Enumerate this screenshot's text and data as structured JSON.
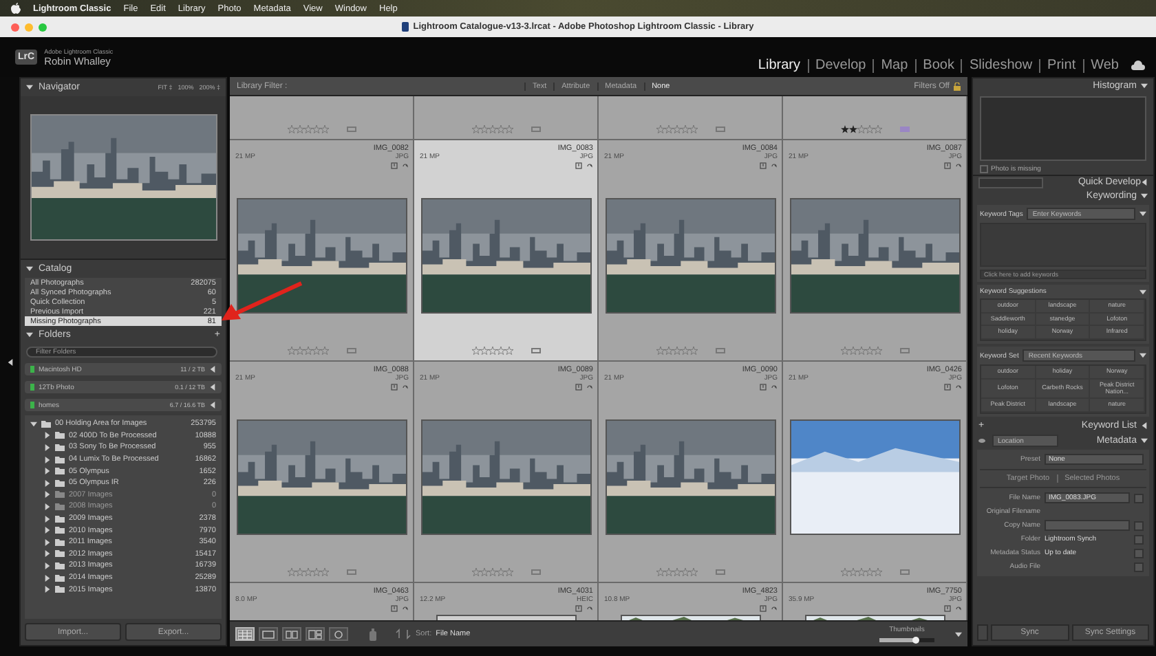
{
  "menu_bar": {
    "app": "Lightroom Classic",
    "items": [
      "File",
      "Edit",
      "Library",
      "Photo",
      "Metadata",
      "View",
      "Window",
      "Help"
    ]
  },
  "window": {
    "title": "Lightroom Catalogue-v13-3.lrcat - Adobe Photoshop Lightroom Classic - Library"
  },
  "identity": {
    "logo": "LrC",
    "product": "Adobe Lightroom Classic",
    "user": "Robin Whalley"
  },
  "modules": [
    {
      "label": "Library",
      "selected": true
    },
    {
      "label": "Develop",
      "selected": false
    },
    {
      "label": "Map",
      "selected": false
    },
    {
      "label": "Book",
      "selected": false
    },
    {
      "label": "Slideshow",
      "selected": false
    },
    {
      "label": "Print",
      "selected": false
    },
    {
      "label": "Web",
      "selected": false
    }
  ],
  "navigator": {
    "title": "Navigator",
    "zoom_options": [
      "FIT ‡",
      "100%",
      "200% ‡"
    ]
  },
  "catalog": {
    "title": "Catalog",
    "items": [
      {
        "label": "All Photographs",
        "count": "282075",
        "selected": false
      },
      {
        "label": "All Synced Photographs",
        "count": "60",
        "selected": false
      },
      {
        "label": "Quick Collection",
        "count": "5",
        "selected": false
      },
      {
        "label": "Previous Import",
        "count": "221",
        "selected": false
      },
      {
        "label": "Missing Photographs",
        "count": "81",
        "selected": true
      }
    ]
  },
  "folders": {
    "title": "Folders",
    "add": "+",
    "filter_placeholder": "Filter Folders",
    "volumes": [
      {
        "name": "Macintosh HD",
        "usage": "11 / 2 TB"
      },
      {
        "name": "12Tb Photo",
        "usage": "0.1 / 12 TB"
      },
      {
        "name": "homes",
        "usage": "6.7 / 16.6 TB"
      }
    ],
    "tree": [
      {
        "label": "00 Holding Area for Images",
        "count": "253795",
        "expanded": true,
        "disabled": false,
        "children": [
          {
            "label": "02 400D To Be Processed",
            "count": "10888",
            "expanded": false,
            "disabled": false
          },
          {
            "label": "03 Sony To Be Processed",
            "count": "955",
            "expanded": false,
            "disabled": false
          },
          {
            "label": "04 Lumix To Be Processed",
            "count": "16862",
            "expanded": false,
            "disabled": false
          },
          {
            "label": "05 Olympus",
            "count": "1652",
            "expanded": false,
            "disabled": false
          },
          {
            "label": "05 Olympus IR",
            "count": "226",
            "expanded": false,
            "disabled": false
          },
          {
            "label": "2007 Images",
            "count": "0",
            "expanded": false,
            "disabled": true
          },
          {
            "label": "2008 Images",
            "count": "0",
            "expanded": false,
            "disabled": true
          },
          {
            "label": "2009 Images",
            "count": "2378",
            "expanded": false,
            "disabled": false
          },
          {
            "label": "2010 Images",
            "count": "7970",
            "expanded": false,
            "disabled": false
          },
          {
            "label": "2011 Images",
            "count": "3540",
            "expanded": false,
            "disabled": false
          },
          {
            "label": "2012 Images",
            "count": "15417",
            "expanded": false,
            "disabled": false
          },
          {
            "label": "2013 Images",
            "count": "16739",
            "expanded": false,
            "disabled": false
          },
          {
            "label": "2014 Images",
            "count": "25289",
            "expanded": false,
            "disabled": false
          },
          {
            "label": "2015 Images",
            "count": "13870",
            "expanded": false,
            "disabled": false
          }
        ]
      }
    ]
  },
  "left_buttons": [
    "Import...",
    "Export..."
  ],
  "library_filter": {
    "label": "Library Filter :",
    "tabs": [
      {
        "label": "Text",
        "selected": false
      },
      {
        "label": "Attribute",
        "selected": false
      },
      {
        "label": "Metadata",
        "selected": false
      },
      {
        "label": "None",
        "selected": true
      }
    ],
    "status": "Filters Off"
  },
  "grid": {
    "rows": [
      {
        "kind": "footer",
        "cells": [
          {
            "stars": 0
          },
          {
            "stars": 0
          },
          {
            "stars": 0
          },
          {
            "stars": 2,
            "color": "#9a86c4"
          }
        ]
      },
      {
        "kind": "full",
        "cells": [
          {
            "name": "IMG_0082",
            "megapixels": "21 MP",
            "format": "JPG",
            "selected": false,
            "stars": 0,
            "kind": "city"
          },
          {
            "name": "IMG_0083",
            "megapixels": "21 MP",
            "format": "JPG",
            "selected": true,
            "stars": 0,
            "kind": "city"
          },
          {
            "name": "IMG_0084",
            "megapixels": "21 MP",
            "format": "JPG",
            "selected": false,
            "stars": 0,
            "kind": "city"
          },
          {
            "name": "IMG_0087",
            "megapixels": "21 MP",
            "format": "JPG",
            "selected": false,
            "stars": 0,
            "kind": "city"
          }
        ]
      },
      {
        "kind": "full",
        "cells": [
          {
            "name": "IMG_0088",
            "megapixels": "21 MP",
            "format": "JPG",
            "selected": false,
            "stars": 0,
            "kind": "city"
          },
          {
            "name": "IMG_0089",
            "megapixels": "21 MP",
            "format": "JPG",
            "selected": false,
            "stars": 0,
            "kind": "city"
          },
          {
            "name": "IMG_0090",
            "megapixels": "21 MP",
            "format": "JPG",
            "selected": false,
            "stars": 0,
            "kind": "city"
          },
          {
            "name": "IMG_0426",
            "megapixels": "21 MP",
            "format": "JPG",
            "selected": false,
            "stars": 0,
            "kind": "snow"
          }
        ]
      },
      {
        "kind": "header",
        "cells": [
          {
            "name": "IMG_0463",
            "megapixels": "8.0 MP",
            "format": "JPG",
            "selected": false,
            "kind": "none"
          },
          {
            "name": "IMG_4031",
            "megapixels": "12.2 MP",
            "format": "HEIC",
            "selected": false,
            "kind": "frame"
          },
          {
            "name": "IMG_4823",
            "megapixels": "10.8 MP",
            "format": "JPG",
            "selected": false,
            "kind": "trees"
          },
          {
            "name": "IMG_7750",
            "megapixels": "35.9 MP",
            "format": "JPG",
            "selected": false,
            "kind": "trees"
          }
        ]
      }
    ]
  },
  "toolbar": {
    "view_modes": [
      {
        "kind": "grid",
        "selected": true
      },
      {
        "kind": "loupe",
        "selected": false
      },
      {
        "kind": "compare",
        "selected": false
      },
      {
        "kind": "survey",
        "selected": false
      },
      {
        "kind": "people",
        "selected": false
      }
    ],
    "sort_label": "Sort:",
    "sort_value": "File Name",
    "thumbnails": {
      "label": "Thumbnails",
      "level": 0.65
    }
  },
  "histogram": {
    "title": "Histogram",
    "note": "Photo is missing",
    "checked": false
  },
  "quick_develop": {
    "title": "Quick Develop"
  },
  "keywording": {
    "title": "Keywording",
    "tags_label": "Keyword Tags",
    "tags_value": "Enter Keywords",
    "add_placeholder": "Click here to add keywords",
    "suggestions_title": "Keyword Suggestions",
    "suggestions": [
      "outdoor",
      "landscape",
      "nature",
      "Saddleworth",
      "stanedge",
      "Lofoton",
      "holiday",
      "Norway",
      "Infrared"
    ],
    "set_label": "Keyword Set",
    "set_value": "Recent Keywords",
    "set_keywords": [
      "outdoor",
      "holiday",
      "Norway",
      "Lofoton",
      "Carbeth Rocks",
      "Peak District Nation...",
      "Peak District",
      "landscape",
      "nature"
    ]
  },
  "keyword_list": {
    "add": "+",
    "title": "Keyword List"
  },
  "metadata": {
    "set_value": "Location",
    "title": "Metadata",
    "preset_label": "Preset",
    "preset_value": "None",
    "targets": [
      "Target Photo",
      "Selected Photos"
    ],
    "fields": [
      {
        "label": "File Name",
        "value": "IMG_0083.JPG",
        "kind": "field"
      },
      {
        "label": "Original Filename",
        "kind": "label"
      },
      {
        "label": "Copy Name",
        "kind": "field"
      },
      {
        "label": "Folder",
        "value": "Lightroom Synch",
        "kind": "text"
      },
      {
        "label": "Metadata Status",
        "value": "Up to date",
        "kind": "text"
      },
      {
        "label": "Audio File",
        "kind": "text"
      }
    ]
  },
  "sync_switch": {
    "on": false
  },
  "right_buttons": [
    "Sync",
    "Sync Settings"
  ]
}
